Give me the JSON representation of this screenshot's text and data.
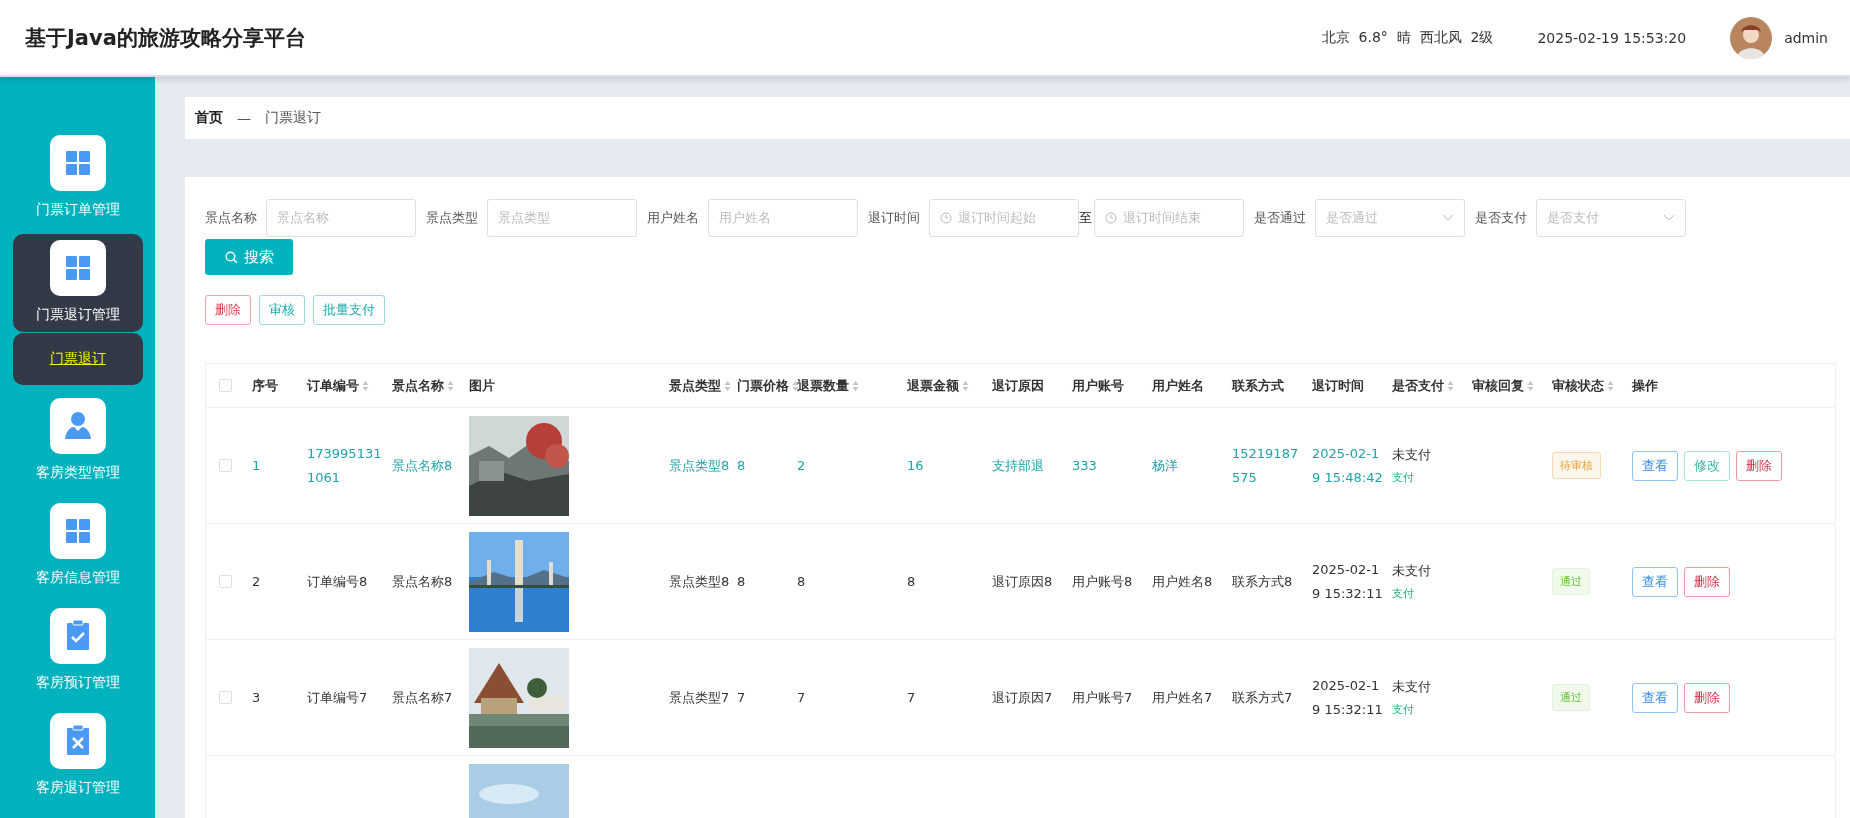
{
  "header": {
    "title": "基于Java的旅游攻略分享平台",
    "weather": "北京  6.8°  晴  西北风  2级",
    "datetime": "2025-02-19 15:53:20",
    "user": "admin"
  },
  "sidebar": {
    "items": [
      {
        "label": "门票订单管理",
        "kind": "grid",
        "selected": false
      },
      {
        "label": "门票退订管理",
        "kind": "grid",
        "selected": true,
        "children": [
          {
            "label": "门票退订",
            "selected": true
          }
        ]
      },
      {
        "label": "客房类型管理",
        "kind": "person",
        "selected": false
      },
      {
        "label": "客房信息管理",
        "kind": "grid",
        "selected": false
      },
      {
        "label": "客房预订管理",
        "kind": "check",
        "selected": false
      },
      {
        "label": "客房退订管理",
        "kind": "cross",
        "selected": false
      }
    ]
  },
  "breadcrumb": {
    "home": "首页",
    "separator": "—",
    "current": "门票退订"
  },
  "filters": [
    {
      "kind": "text",
      "label": "景点名称",
      "placeholder": "景点名称"
    },
    {
      "kind": "text",
      "label": "景点类型",
      "placeholder": "景点类型"
    },
    {
      "kind": "text",
      "label": "用户姓名",
      "placeholder": "用户姓名"
    },
    {
      "kind": "daterange",
      "label": "退订时间",
      "placeholder": "退订时间起始",
      "separator": "至",
      "end_placeholder": "退订时间结束"
    },
    {
      "kind": "select",
      "label": "是否通过",
      "placeholder": "是否通过"
    },
    {
      "kind": "select",
      "label": "是否支付",
      "placeholder": "是否支付"
    }
  ],
  "search_button": "搜索",
  "bulk_actions": [
    {
      "label": "删除",
      "kind": "danger"
    },
    {
      "label": "审核",
      "kind": "primary"
    },
    {
      "label": "批量支付",
      "kind": "primary"
    }
  ],
  "table": {
    "select_all_checked": false,
    "columns": [
      {
        "label": "序号",
        "sortable": false
      },
      {
        "label": "订单编号",
        "sortable": true
      },
      {
        "label": "景点名称",
        "sortable": true
      },
      {
        "label": "图片",
        "sortable": false
      },
      {
        "label": "景点类型",
        "sortable": true
      },
      {
        "label": "门票价格",
        "sortable": true
      },
      {
        "label": "退票数量",
        "sortable": true
      },
      {
        "label": "退票金额",
        "sortable": true
      },
      {
        "label": "退订原因",
        "sortable": false
      },
      {
        "label": "用户账号",
        "sortable": false
      },
      {
        "label": "用户姓名",
        "sortable": false
      },
      {
        "label": "联系方式",
        "sortable": false
      },
      {
        "label": "退订时间",
        "sortable": false
      },
      {
        "label": "是否支付",
        "sortable": true
      },
      {
        "label": "审核回复",
        "sortable": true
      },
      {
        "label": "审核状态",
        "sortable": true
      },
      {
        "label": "操作",
        "sortable": false
      }
    ],
    "rows": [
      {
        "kind": "full",
        "selected": true,
        "checked": false,
        "cells": [
          "1",
          "1739951311061",
          "景点名称8",
          null,
          "景点类型8",
          "8",
          "2",
          "16",
          "支持部退",
          "333",
          "杨洋",
          "15219187575",
          "2025-02-19 15:48:42"
        ],
        "payment": {
          "status": "未支付",
          "action": "支付"
        },
        "review": {
          "label": "待审核",
          "kind": "pending"
        },
        "actions": [
          {
            "label": "查看",
            "kind": "view"
          },
          {
            "label": "修改",
            "kind": "edit"
          },
          {
            "label": "删除",
            "kind": "delete"
          }
        ]
      },
      {
        "kind": "full",
        "selected": false,
        "checked": false,
        "cells": [
          "2",
          "订单编号8",
          "景点名称8",
          null,
          "景点类型8",
          "8",
          "8",
          "8",
          "退订原因8",
          "用户账号8",
          "用户姓名8",
          "联系方式8",
          "2025-02-19 15:32:11"
        ],
        "payment": {
          "status": "未支付",
          "action": "支付"
        },
        "review": {
          "label": "通过",
          "kind": "passed"
        },
        "actions": [
          {
            "label": "查看",
            "kind": "view"
          },
          {
            "label": "删除",
            "kind": "delete"
          }
        ]
      },
      {
        "kind": "full",
        "selected": false,
        "checked": false,
        "cells": [
          "3",
          "订单编号7",
          "景点名称7",
          null,
          "景点类型7",
          "7",
          "7",
          "7",
          "退订原因7",
          "用户账号7",
          "用户姓名7",
          "联系方式7",
          "2025-02-19 15:32:11"
        ],
        "payment": {
          "status": "未支付",
          "action": "支付"
        },
        "review": {
          "label": "通过",
          "kind": "passed"
        },
        "actions": [
          {
            "label": "查看",
            "kind": "view"
          },
          {
            "label": "删除",
            "kind": "delete"
          }
        ]
      },
      {
        "kind": "partial"
      }
    ]
  }
}
